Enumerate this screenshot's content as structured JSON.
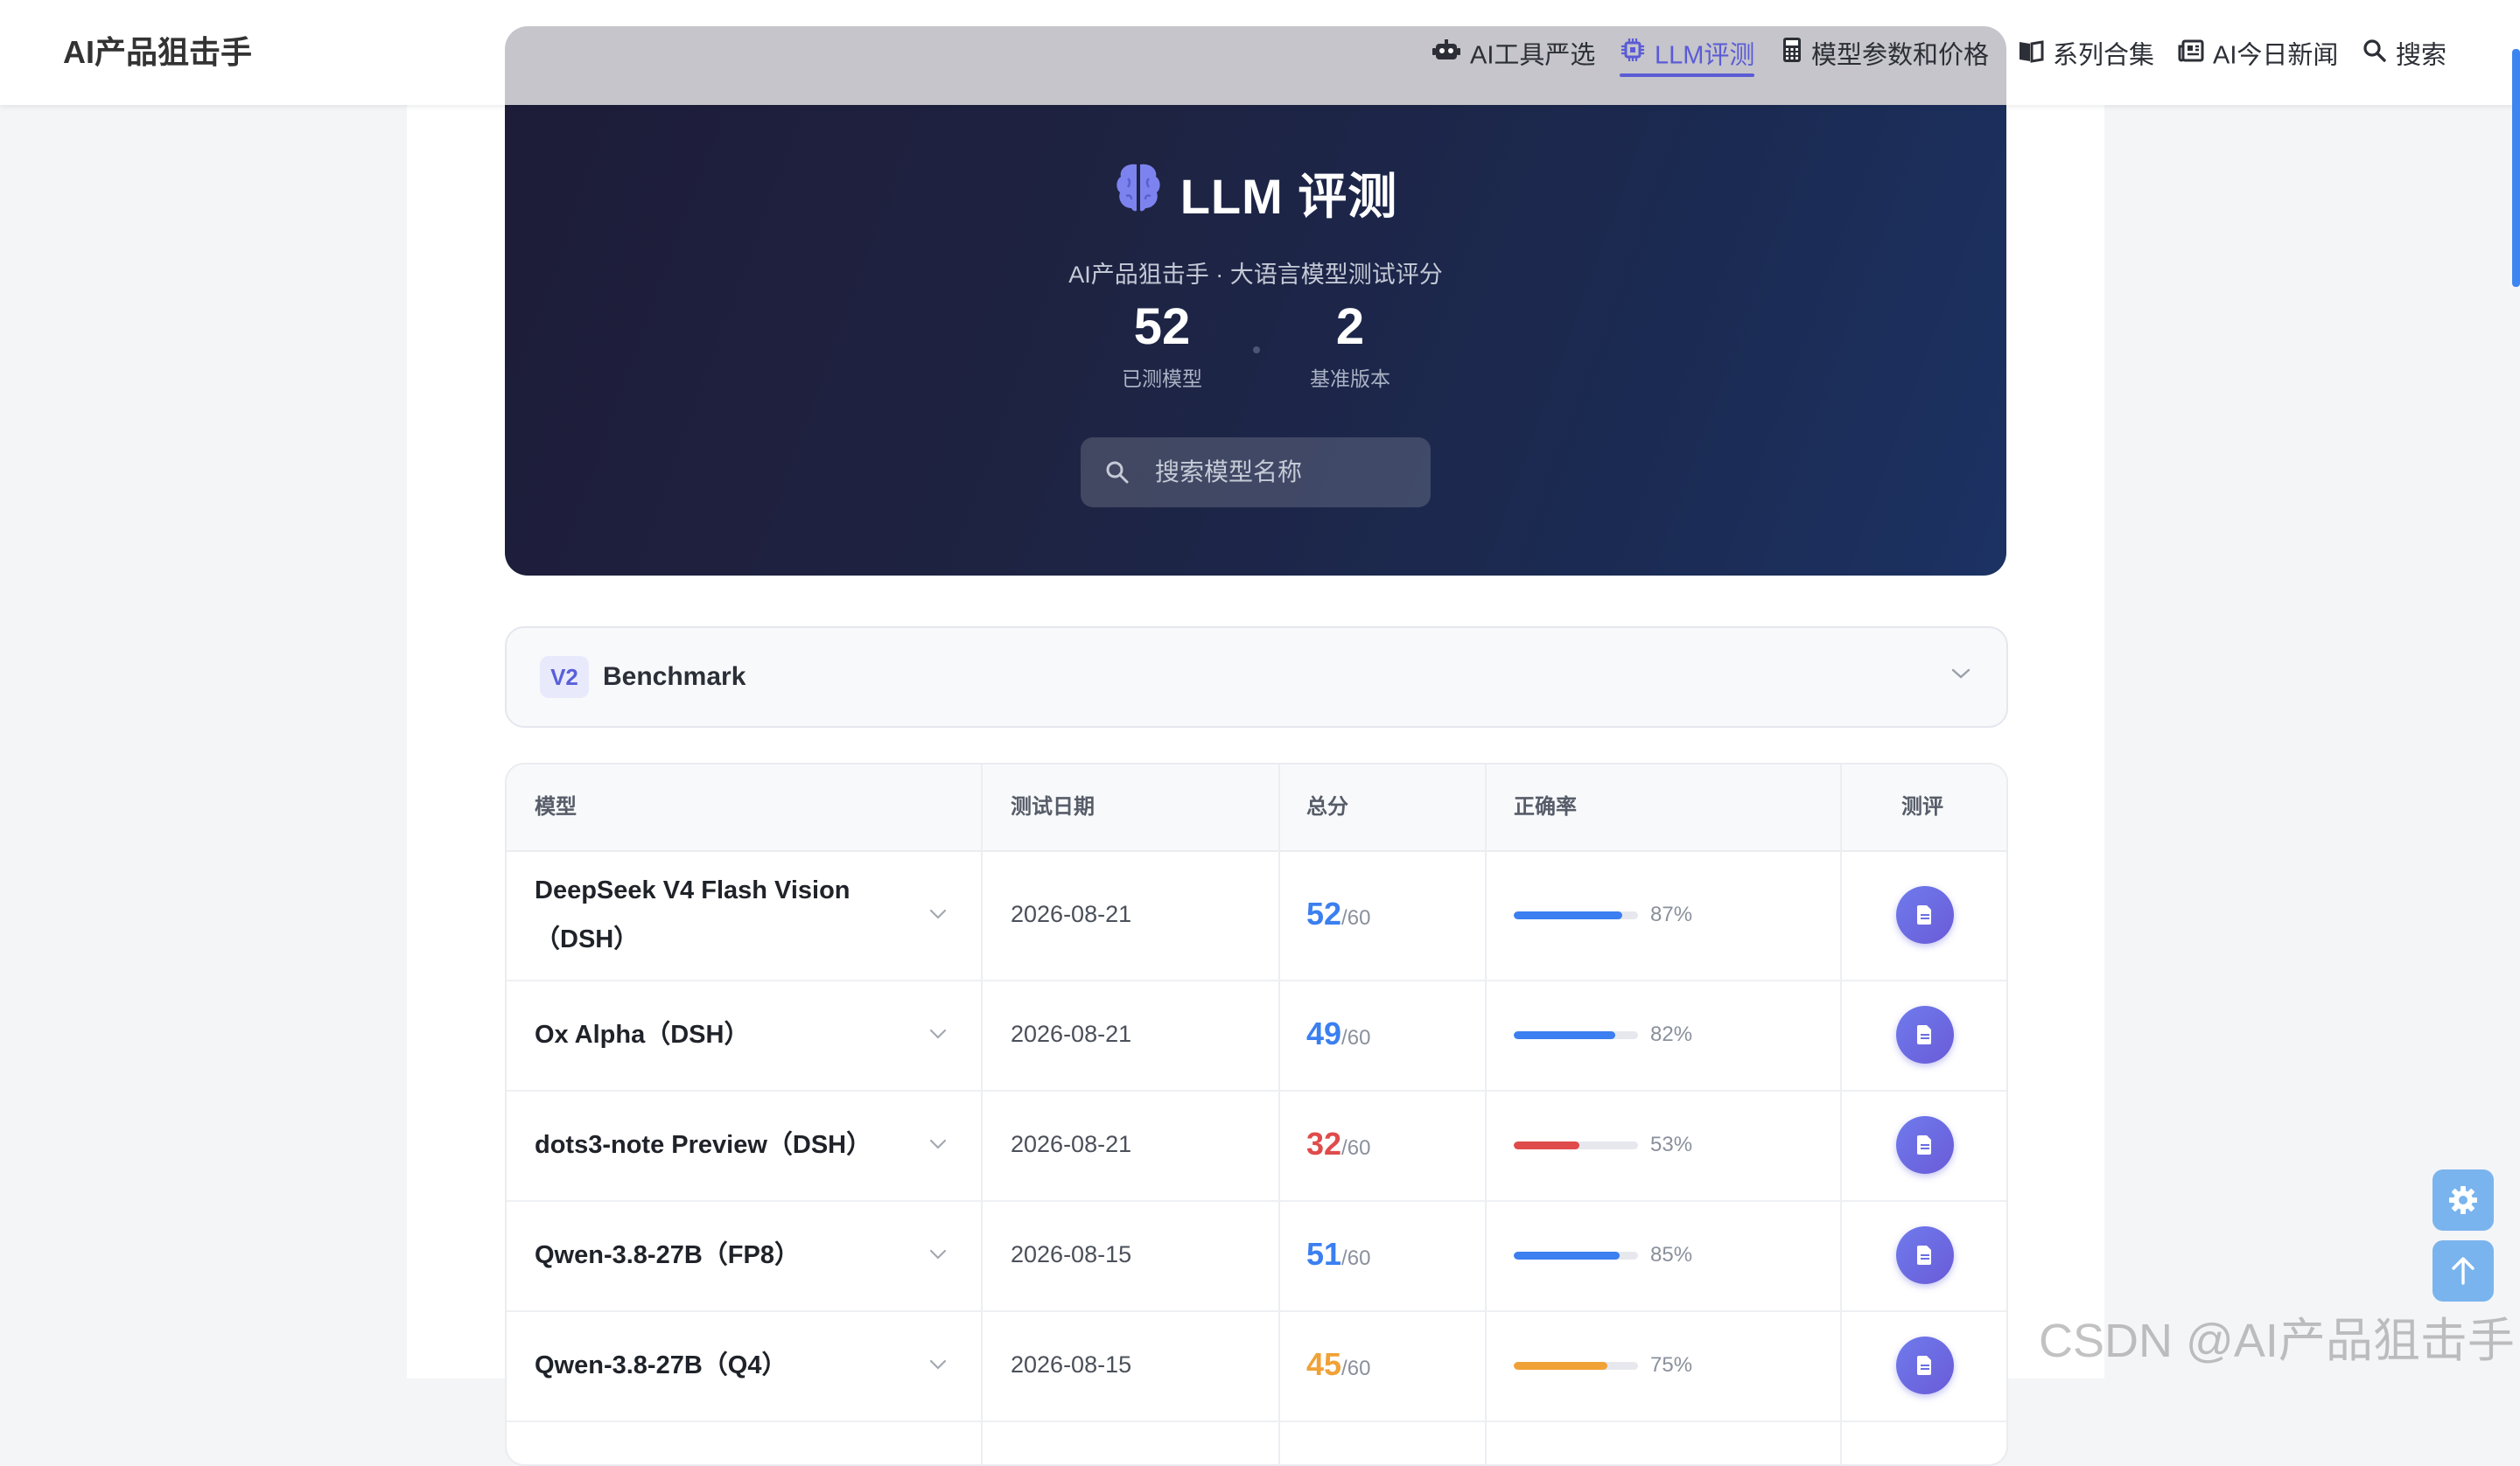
{
  "nav": {
    "brand": "AI产品狙击手",
    "items": [
      {
        "label": "AI工具严选",
        "icon": "robot-icon"
      },
      {
        "label": "LLM评测",
        "icon": "chip-icon",
        "active": true
      },
      {
        "label": "模型参数和价格",
        "icon": "calculator-icon"
      },
      {
        "label": "系列合集",
        "icon": "book-icon"
      },
      {
        "label": "AI今日新闻",
        "icon": "newspaper-icon"
      },
      {
        "label": "搜索",
        "icon": "search-icon"
      }
    ]
  },
  "hero": {
    "title": "LLM 评测",
    "subtitle": "AI产品狙击手 · 大语言模型测试评分",
    "stats": [
      {
        "value": "52",
        "label": "已测模型"
      },
      {
        "value": "2",
        "label": "基准版本"
      }
    ],
    "search_placeholder": "搜索模型名称"
  },
  "benchmark": {
    "badge": "V2",
    "label": "Benchmark"
  },
  "table": {
    "headers": [
      "模型",
      "测试日期",
      "总分",
      "正确率",
      "测评"
    ],
    "rows": [
      {
        "model": "DeepSeek V4 Flash Vision（DSH）",
        "date": "2026-08-21",
        "score": "52",
        "max": "/60",
        "pct": "87%",
        "fraction": 0.87,
        "color": "#3b7ff0"
      },
      {
        "model": "Ox Alpha（DSH）",
        "date": "2026-08-21",
        "score": "49",
        "max": "/60",
        "pct": "82%",
        "fraction": 0.82,
        "color": "#3b7ff0"
      },
      {
        "model": "dots3-note Preview（DSH）",
        "date": "2026-08-21",
        "score": "32",
        "max": "/60",
        "pct": "53%",
        "fraction": 0.53,
        "color": "#e04b4b"
      },
      {
        "model": "Qwen-3.8-27B（FP8）",
        "date": "2026-08-15",
        "score": "51",
        "max": "/60",
        "pct": "85%",
        "fraction": 0.85,
        "color": "#3b7ff0"
      },
      {
        "model": "Qwen-3.8-27B（Q4）",
        "date": "2026-08-15",
        "score": "45",
        "max": "/60",
        "pct": "75%",
        "fraction": 0.75,
        "color": "#f0a236"
      }
    ]
  },
  "watermark": "CSDN @AI产品狙击手"
}
